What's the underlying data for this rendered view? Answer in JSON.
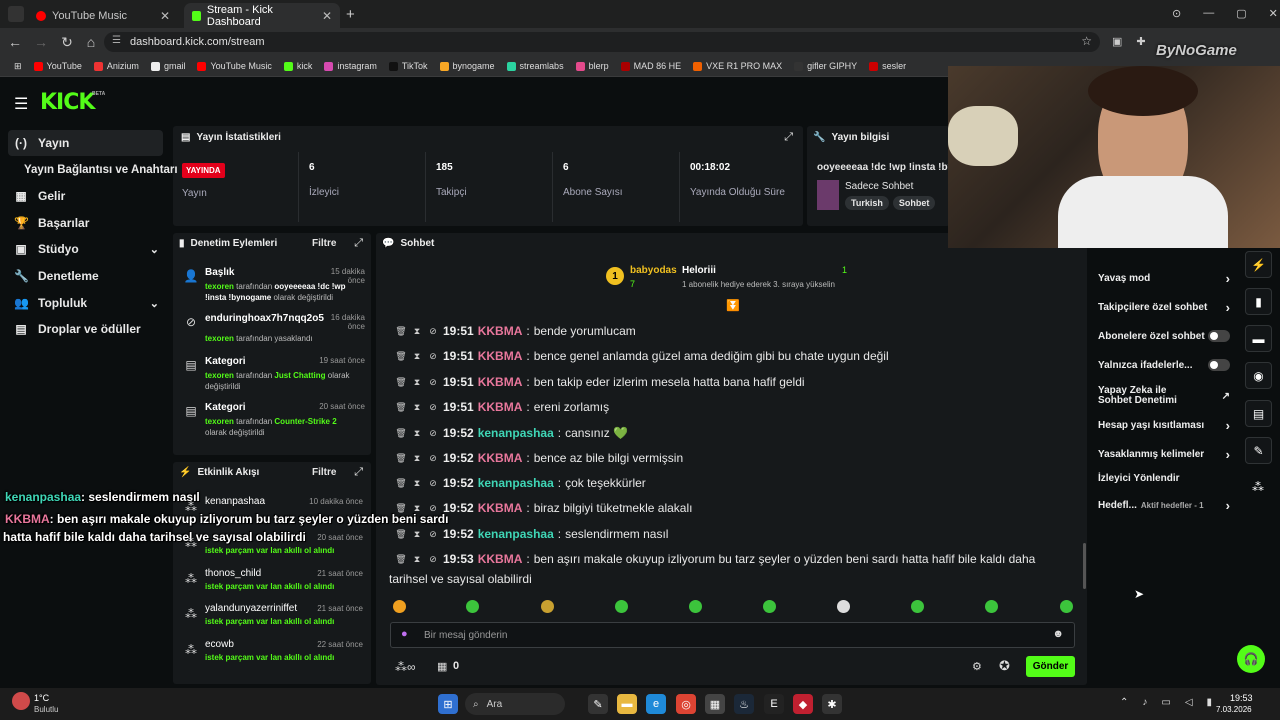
{
  "browser": {
    "tabs": [
      {
        "title": "YouTube Music",
        "active": false
      },
      {
        "title": "Stream - Kick Dashboard",
        "active": true
      }
    ],
    "url": "dashboard.kick.com/stream",
    "bookmarks": [
      "YouTube",
      "Anizium",
      "gmail",
      "YouTube Music",
      "kick",
      "instagram",
      "TikTok",
      "bynogame",
      "streamlabs",
      "blerp",
      "MAD 86 HE",
      "VXE R1 PRO MAX",
      "gifler GIPHY",
      "sesler"
    ]
  },
  "kick": {
    "logo": "KICK",
    "beta": "BETA",
    "sidebar": [
      {
        "label": "Yayın",
        "icon": "stream-icon"
      },
      {
        "label": "Yayın Bağlantısı ve Anahtarı",
        "icon": ""
      },
      {
        "label": "Gelir",
        "icon": "revenue-icon"
      },
      {
        "label": "Başarılar",
        "icon": "achievements-icon"
      },
      {
        "label": "Stüdyo",
        "icon": "studio-icon"
      },
      {
        "label": "Denetleme",
        "icon": "moderation-icon"
      },
      {
        "label": "Topluluk",
        "icon": "community-icon"
      },
      {
        "label": "Droplar ve ödüller",
        "icon": "drops-icon"
      }
    ],
    "stats": {
      "title": "Yayın İstatistikleri",
      "live_badge": "YAYINDA",
      "items": [
        {
          "value": "",
          "label": "Yayın"
        },
        {
          "value": "6",
          "label": "İzleyici"
        },
        {
          "value": "185",
          "label": "Takipçi"
        },
        {
          "value": "6",
          "label": "Abone Sayısı"
        },
        {
          "value": "00:18:02",
          "label": "Yayında Olduğu Süre"
        }
      ]
    },
    "stream_info": {
      "title": "Yayın bilgisi",
      "stream_title": "ooyeeeeaa !dc !wp !insta !byn",
      "category": "Sadece Sohbet",
      "tags": [
        "Turkish",
        "Sohbet"
      ]
    },
    "mod_actions": {
      "title": "Denetim Eylemleri",
      "filter": "Filtre",
      "items": [
        {
          "title": "Başlık",
          "time": "15 dakika önce",
          "actor": "texoren",
          "pre": "tarafından",
          "highlight": "ooyeeeeaa !dc !wp !insta !bynogame",
          "post": "olarak değiştirildi"
        },
        {
          "title": "enduringhoax7h7nqq2o5",
          "time": "16 dakika önce",
          "actor": "texoren",
          "pre": "tarafından yasaklandı",
          "highlight": "",
          "post": ""
        },
        {
          "title": "Kategori",
          "time": "19 saat önce",
          "actor": "texoren",
          "pre": "tarafından",
          "highlight": "Just Chatting",
          "post": "olarak değiştirildi"
        },
        {
          "title": "Kategori",
          "time": "20 saat önce",
          "actor": "texoren",
          "pre": "tarafından",
          "highlight": "Counter-Strike 2",
          "post": "olarak değiştirildi"
        }
      ]
    },
    "activity": {
      "title": "Etkinlik Akışı",
      "filter": "Filtre",
      "items": [
        {
          "user": "kenanpashaa",
          "time": "10 dakika önce",
          "desc": ""
        },
        {
          "user": "",
          "time": "20 saat önce",
          "desc": "istek parçam var lan akıllı ol alındı"
        },
        {
          "user": "thonos_child",
          "time": "21 saat önce",
          "desc": "istek parçam var lan akıllı ol alındı"
        },
        {
          "user": "yalandunyazerriniffet",
          "time": "21 saat önce",
          "desc": "istek parçam var lan akıllı ol alındı"
        },
        {
          "user": "ecowb",
          "time": "22 saat önce",
          "desc": "istek parçam var lan akıllı ol alındı"
        }
      ]
    },
    "chat": {
      "title": "Sohbet",
      "pinned_user1": "babyodas",
      "pinned_count1": "7",
      "pinned_user2": "Heloriii",
      "pinned_count2": "1",
      "pinned_note": "1 abonelik hediye ederek 3. sıraya yükselin",
      "messages": [
        {
          "time": "19:51",
          "user": "KKBMA",
          "text": "bende yorumlucam"
        },
        {
          "time": "19:51",
          "user": "KKBMA",
          "text": "bence genel anlamda güzel ama dediğim gibi bu chate uygun değil"
        },
        {
          "time": "19:51",
          "user": "KKBMA",
          "text": "ben takip eder izlerim mesela hatta bana hafif geldi"
        },
        {
          "time": "19:51",
          "user": "KKBMA",
          "text": "ereni zorlamış"
        },
        {
          "time": "19:52",
          "user": "kenanpashaa",
          "text": "cansınız 💚"
        },
        {
          "time": "19:52",
          "user": "KKBMA",
          "text": "bence az bile bilgi vermişsin"
        },
        {
          "time": "19:52",
          "user": "kenanpashaa",
          "text": "çok teşekkürler"
        },
        {
          "time": "19:52",
          "user": "KKBMA",
          "text": "biraz bilgiyi tüketmekle alakalı"
        },
        {
          "time": "19:52",
          "user": "kenanpashaa",
          "text": "seslendirmem nasıl"
        },
        {
          "time": "19:53",
          "user": "KKBMA",
          "text": "ben aşırı makale okuyup izliyorum bu tarz şeyler o yüzden beni sardı hatta hafif bile kaldı daha"
        },
        {
          "time": "",
          "user": "",
          "text": "tarihsel ve sayısal olabilirdi"
        }
      ],
      "input_placeholder": "Bir mesaj gönderin",
      "points": "0",
      "send": "Gönder"
    },
    "settings": [
      {
        "label": "Yavaş mod",
        "type": "chevron"
      },
      {
        "label": "Takipçilere özel sohbet",
        "type": "chevron"
      },
      {
        "label": "Abonelere özel sohbet",
        "type": "toggle"
      },
      {
        "label": "Yalnızca ifadelerle...",
        "type": "toggle"
      },
      {
        "label": "Yapay Zeka ile Sohbet Denetimi",
        "type": "link"
      },
      {
        "label": "Hesap yaşı kısıtlaması",
        "type": "chevron"
      },
      {
        "label": "Yasaklanmış kelimeler",
        "type": "chevron"
      },
      {
        "label": "İzleyici Yönlendir",
        "type": "none"
      },
      {
        "label": "Hedefl...",
        "type": "chevron",
        "extra": "Aktif hedefler - 1"
      }
    ]
  },
  "overlay": {
    "watermark": "ByNoGame",
    "line1_user": "kenanpashaa",
    "line1_text": ": seslendirmem nasıl",
    "line2_user": "KKBMA",
    "line2_text": ": ben aşırı makale okuyup izliyorum bu tarz şeyler o yüzden beni sardı",
    "line3_text": "hatta hafif bile kaldı daha tarihsel ve sayısal olabilirdi"
  },
  "taskbar": {
    "weather_temp": "1°C",
    "weather_desc": "Bulutlu",
    "search": "Ara",
    "time": "19:53",
    "date": "7.03.2026"
  }
}
